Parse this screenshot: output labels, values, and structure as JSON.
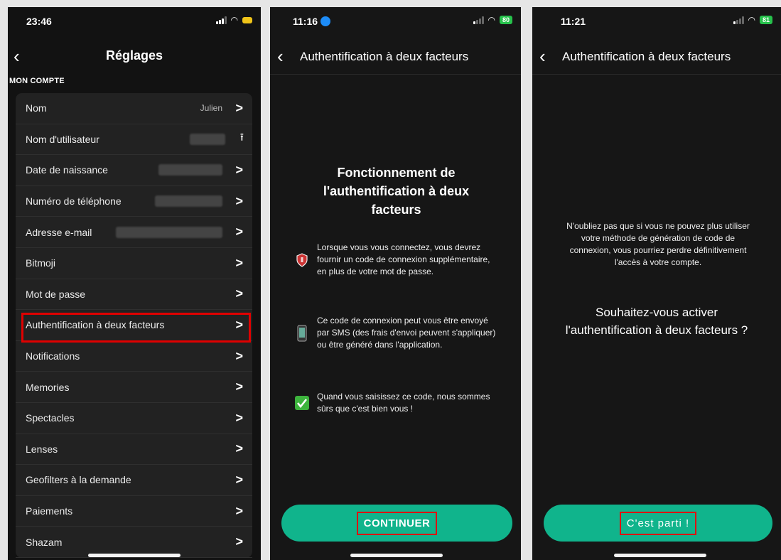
{
  "panel1": {
    "time": "23:46",
    "title": "Réglages",
    "section": "MON COMPTE",
    "rows": [
      {
        "label": "Nom",
        "value": "Julien"
      },
      {
        "label": "Nom d'utilisateur"
      },
      {
        "label": "Date de naissance"
      },
      {
        "label": "Numéro de téléphone"
      },
      {
        "label": "Adresse e-mail"
      },
      {
        "label": "Bitmoji"
      },
      {
        "label": "Mot de passe"
      },
      {
        "label": "Authentification à deux facteurs"
      },
      {
        "label": "Notifications"
      },
      {
        "label": "Memories"
      },
      {
        "label": "Spectacles"
      },
      {
        "label": "Lenses"
      },
      {
        "label": "Geofilters à la demande"
      },
      {
        "label": "Paiements"
      },
      {
        "label": "Shazam"
      }
    ]
  },
  "panel2": {
    "time": "11:16",
    "battery": "80",
    "title": "Authentification à deux facteurs",
    "heading": "Fonctionnement de l'authentification à deux facteurs",
    "items": [
      {
        "icon": "shield-icon",
        "text": "Lorsque vous vous connectez, vous devrez fournir un code de connexion supplémentaire, en plus de votre mot de passe."
      },
      {
        "icon": "phone-icon",
        "text": "Ce code de connexion peut vous être envoyé par SMS (des frais d'envoi peuvent s'appliquer) ou être généré dans l'application."
      },
      {
        "icon": "check-icon",
        "text": "Quand vous saisissez ce code, nous sommes sûrs que c'est bien vous !"
      }
    ],
    "button": "CONTINUER"
  },
  "panel3": {
    "time": "11:21",
    "battery": "81",
    "title": "Authentification à deux facteurs",
    "note": "N'oubliez pas que si vous ne pouvez plus utiliser votre méthode de génération de code de connexion, vous pourriez perdre définitivement l'accès à votre compte.",
    "question": "Souhaitez-vous activer l'authentification à deux facteurs ?",
    "button": "C'est parti !"
  },
  "colors": {
    "accent": "#10b48c",
    "highlight": "#e00000",
    "background": "#161616"
  }
}
